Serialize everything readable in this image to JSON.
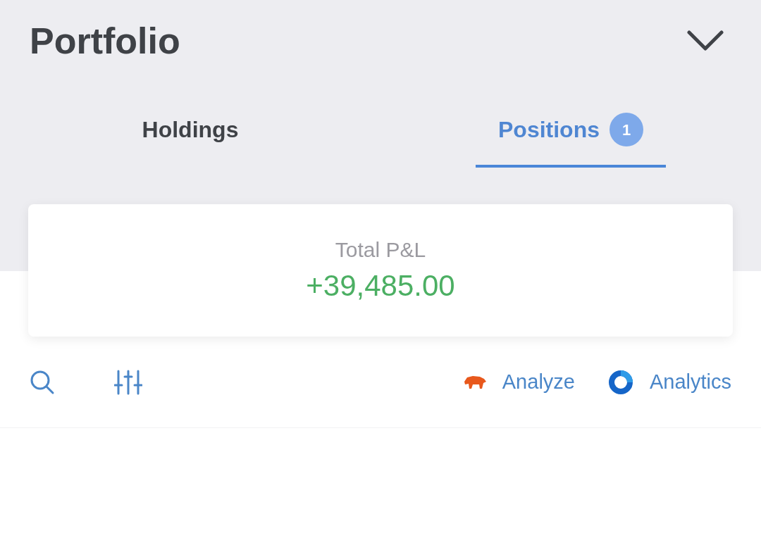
{
  "header": {
    "title": "Portfolio"
  },
  "tabs": [
    {
      "label": "Holdings",
      "selected": false
    },
    {
      "label": "Positions",
      "selected": true,
      "badge": "1"
    }
  ],
  "summary": {
    "label": "Total P&L",
    "value": "+39,485.00"
  },
  "toolbar": {
    "actions": [
      {
        "kind": "analyze",
        "label": "Analyze"
      },
      {
        "kind": "analytics",
        "label": "Analytics"
      }
    ]
  }
}
